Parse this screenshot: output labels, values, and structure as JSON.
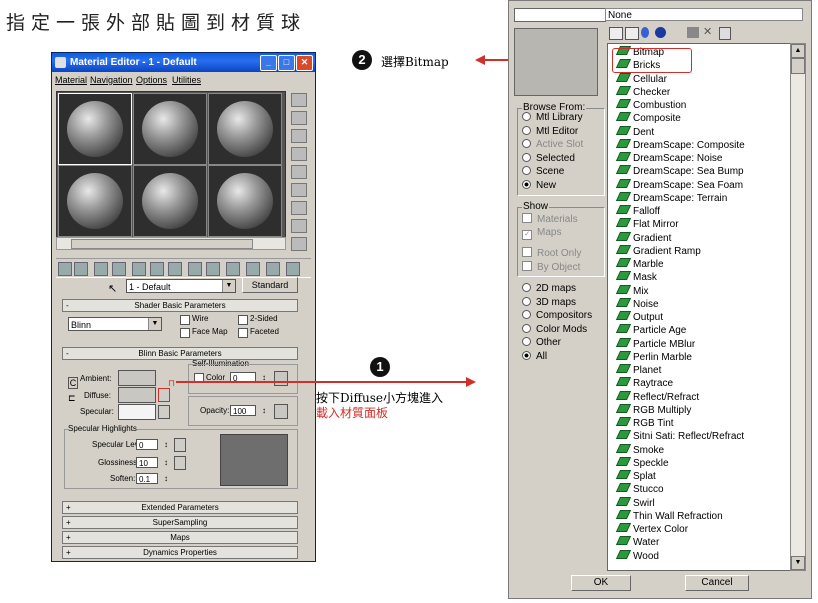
{
  "heading": "指定一張外部貼圖到材質球",
  "material_editor": {
    "title": "Material Editor - 1 - Default",
    "menu": [
      "Material",
      "Navigation",
      "Options",
      "Utilities"
    ],
    "material_name": "1 - Default",
    "type_button": "Standard",
    "shader_rollout": "Shader Basic Parameters",
    "shader": "Blinn",
    "shader_checks": [
      "Wire",
      "2-Sided",
      "Face Map",
      "Faceted"
    ],
    "blinn_rollout": "Blinn Basic Parameters",
    "self_illum_title": "Self-Illumination",
    "color_label": "Color",
    "color_value": "0",
    "ambient_label": "Ambient:",
    "diffuse_label": "Diffuse:",
    "specular_label": "Specular:",
    "opacity_label": "Opacity:",
    "opacity_value": "100",
    "spec_highlights_title": "Specular Highlights",
    "specular_level_label": "Specular Level:",
    "specular_level_value": "0",
    "glossiness_label": "Glossiness:",
    "glossiness_value": "10",
    "soften_label": "Soften:",
    "soften_value": "0.1",
    "rollouts_collapsed": [
      "Extended Parameters",
      "SuperSampling",
      "Maps",
      "Dynamics Properties"
    ]
  },
  "annotations": {
    "step1_number": "1",
    "step1_text_line1": "按下Diffuse小方塊進入",
    "step1_text_line2": "載入材質面板",
    "step2_number": "2",
    "step2_text": "選擇Bitmap",
    "accent_color": "#d0302a"
  },
  "browser": {
    "current": "None",
    "browse_from_title": "Browse From:",
    "browse_from": [
      {
        "label": "Mtl Library",
        "selected": false,
        "enabled": true
      },
      {
        "label": "Mtl Editor",
        "selected": false,
        "enabled": true
      },
      {
        "label": "Active Slot",
        "selected": false,
        "enabled": false
      },
      {
        "label": "Selected",
        "selected": false,
        "enabled": true
      },
      {
        "label": "Scene",
        "selected": false,
        "enabled": true
      },
      {
        "label": "New",
        "selected": true,
        "enabled": true
      }
    ],
    "show_title": "Show",
    "show": [
      {
        "label": "Materials",
        "checked": false,
        "enabled": false
      },
      {
        "label": "Maps",
        "checked": true,
        "enabled": false
      },
      {
        "label": "Root Only",
        "checked": false,
        "enabled": false
      },
      {
        "label": "By Object",
        "checked": false,
        "enabled": false
      }
    ],
    "categories": [
      {
        "label": "2D maps",
        "selected": false
      },
      {
        "label": "3D maps",
        "selected": false
      },
      {
        "label": "Compositors",
        "selected": false
      },
      {
        "label": "Color Mods",
        "selected": false
      },
      {
        "label": "Other",
        "selected": false
      },
      {
        "label": "All",
        "selected": true
      }
    ],
    "maps": [
      "Bitmap",
      "Bricks",
      "Cellular",
      "Checker",
      "Combustion",
      "Composite",
      "Dent",
      "DreamScape: Composite",
      "DreamScape: Noise",
      "DreamScape: Sea Bump",
      "DreamScape: Sea Foam",
      "DreamScape: Terrain",
      "Falloff",
      "Flat Mirror",
      "Gradient",
      "Gradient Ramp",
      "Marble",
      "Mask",
      "Mix",
      "Noise",
      "Output",
      "Particle Age",
      "Particle MBlur",
      "Perlin Marble",
      "Planet",
      "Raytrace",
      "Reflect/Refract",
      "RGB Multiply",
      "RGB Tint",
      "Sitni Sati: Reflect/Refract",
      "Smoke",
      "Speckle",
      "Splat",
      "Stucco",
      "Swirl",
      "Thin Wall Refraction",
      "Vertex Color",
      "Water",
      "Wood"
    ],
    "ok_label": "OK",
    "cancel_label": "Cancel"
  }
}
